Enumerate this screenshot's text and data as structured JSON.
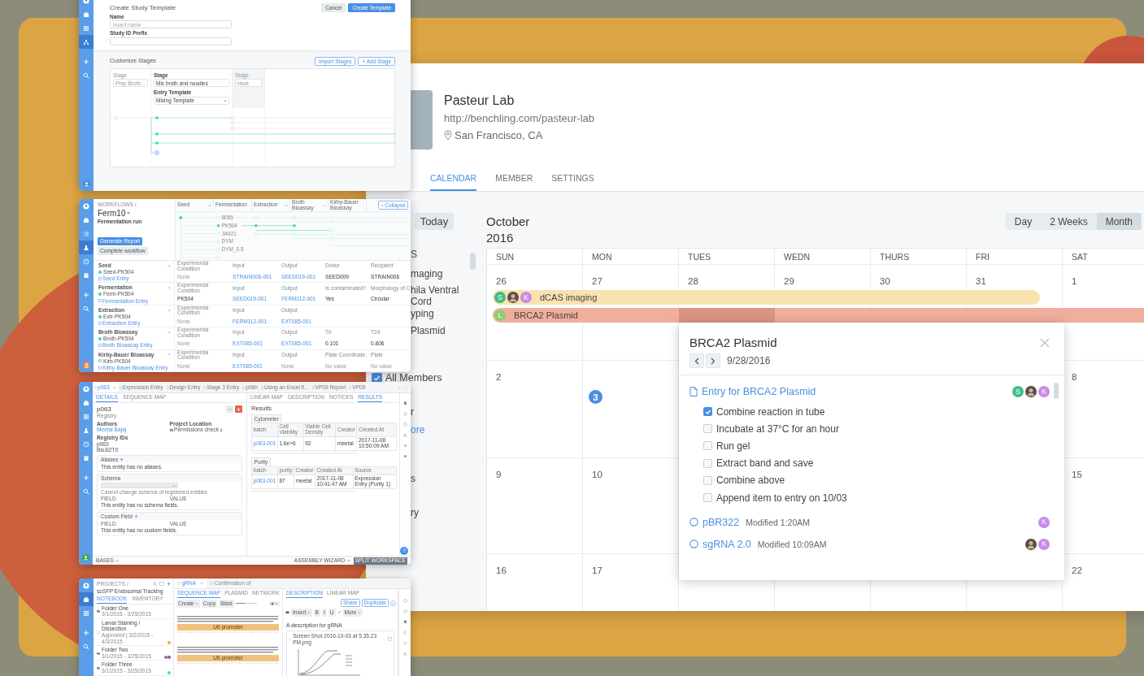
{
  "study_template": {
    "sidebar": [
      {
        "kind": "logo",
        "selected": false
      },
      {
        "kind": "briefcase",
        "selected": false
      },
      {
        "kind": "grid",
        "selected": false
      },
      {
        "kind": "hierarchy",
        "selected": true
      },
      {
        "kind": "plus",
        "selected": false
      },
      {
        "kind": "search",
        "selected": false
      }
    ],
    "title": "Create Study Template",
    "buttons": [
      {
        "label": "Cancel",
        "kind": "secondary"
      },
      {
        "label": "Create Template",
        "kind": "primary"
      }
    ],
    "fields": [
      {
        "label": "Name",
        "placeholder": "Insert name"
      },
      {
        "label": "Study ID Prefix"
      }
    ],
    "stages_title": "Customize Stages",
    "stage_buttons": [
      "Import Stages",
      "+ Add Stage"
    ],
    "stages": [
      {
        "label": "Stage",
        "value": "Prep Broth...",
        "active": false,
        "hovered": false
      },
      {
        "label": "Stage",
        "value": "Mix broth and noodles",
        "active": true,
        "hovered": false,
        "template_label": "Entry Template",
        "template": "Mixing Template"
      },
      {
        "label": "Stage",
        "value": "Heat",
        "active": false,
        "hovered": true
      }
    ]
  },
  "workflow": {
    "sidebar": [
      {
        "kind": "logo",
        "selected": false
      },
      {
        "kind": "briefcase",
        "selected": false
      },
      {
        "kind": "list",
        "selected": false
      },
      {
        "kind": "flask",
        "selected": true
      },
      {
        "kind": "clock",
        "selected": false
      },
      {
        "kind": "book",
        "selected": false
      },
      {
        "kind": "plus",
        "selected": false
      },
      {
        "kind": "search",
        "selected": false
      }
    ],
    "breadcrumb": "WORKFLOWS /",
    "title": "Ferm10",
    "subtitle": "Fermentation run",
    "buttons": [
      {
        "label": "Generate Report",
        "kind": "primary"
      },
      {
        "label": "Complete workflow",
        "kind": "secondary"
      }
    ],
    "columns": [
      "Seed",
      "Fermentation",
      "Extraction",
      "Broth Bioassay",
      "Kirby-Bauer Bioassay"
    ],
    "collapse": "Collapse",
    "nodes": [
      "8085",
      "PK504",
      "JA921",
      "DYM",
      "DYM_0.5"
    ],
    "stages": [
      {
        "name": "Seed",
        "entity": "Seed-PK504",
        "entry": "Seed Entry",
        "complete": true,
        "fields": [
          {
            "label": "Experimental Condition",
            "value": "None",
            "kind": "empty"
          },
          {
            "label": "Input",
            "value": "STRAIN006-001",
            "kind": "link"
          },
          {
            "label": "Output",
            "value": "SEED019-001",
            "kind": "link"
          },
          {
            "label": "Donor",
            "value": "SEED009",
            "kind": "text"
          },
          {
            "label": "Recipient",
            "value": "STRAIN006",
            "kind": "text"
          }
        ]
      },
      {
        "name": "Fermentation",
        "entity": "Ferm-PK504",
        "entry": "Fermentation Entry",
        "complete": true,
        "fields": [
          {
            "label": "Experimental Condition",
            "value": "PK504",
            "kind": "text"
          },
          {
            "label": "Input",
            "value": "SEED019-001",
            "kind": "link"
          },
          {
            "label": "Output",
            "value": "FERM112-001",
            "kind": "link"
          },
          {
            "label": "Is contaminated?",
            "value": "Yes",
            "kind": "text"
          },
          {
            "label": "Morphology of C",
            "value": "Circular",
            "kind": "text"
          }
        ]
      },
      {
        "name": "Extraction",
        "entity": "Extr-PK504",
        "entry": "Extraction Entry",
        "complete": true,
        "fields": [
          {
            "label": "Experimental Condition",
            "value": "None",
            "kind": "empty"
          },
          {
            "label": "Input",
            "value": "FERM112-001",
            "kind": "link"
          },
          {
            "label": "Output",
            "value": "EXT085-001",
            "kind": "link"
          }
        ]
      },
      {
        "name": "Broth Bioassay",
        "entity": "Broth-PK504",
        "entry": "Broth Bioassay Entry",
        "complete": true,
        "fields": [
          {
            "label": "Experimental Condition",
            "value": "None",
            "kind": "empty"
          },
          {
            "label": "Input",
            "value": "EXT085-001",
            "kind": "link"
          },
          {
            "label": "Output",
            "value": "EXT085-001",
            "kind": "link"
          },
          {
            "label": "T0",
            "value": "0.101",
            "kind": "text"
          },
          {
            "label": "T24",
            "value": "0.806",
            "kind": "text"
          }
        ]
      },
      {
        "name": "Kirby-Bauer Bioassay",
        "entity": "Kirb-PK504",
        "entry": "Kirby-Bauer Bioassay Entry",
        "complete": false,
        "fields": [
          {
            "label": "Experimental Condition",
            "value": "None",
            "kind": "empty"
          },
          {
            "label": "Input",
            "value": "EXT085-001",
            "kind": "link"
          },
          {
            "label": "Output",
            "value": "None",
            "kind": "empty"
          },
          {
            "label": "Plate Coordinate",
            "value": "No value",
            "kind": "empty"
          },
          {
            "label": "Plate",
            "value": "No value",
            "kind": "empty"
          }
        ]
      }
    ]
  },
  "entity": {
    "sidebar": [
      {
        "kind": "logo",
        "selected": false
      },
      {
        "kind": "briefcase",
        "selected": false
      },
      {
        "kind": "grid",
        "selected": false
      },
      {
        "kind": "flask",
        "selected": false
      },
      {
        "kind": "clock",
        "selected": false
      },
      {
        "kind": "book",
        "selected": false
      },
      {
        "kind": "plus",
        "selected": false
      },
      {
        "kind": "search",
        "selected": false
      }
    ],
    "tabs": [
      {
        "label": "p063",
        "selected": true
      },
      {
        "label": "Expression Entry",
        "selected": false
      },
      {
        "label": "Design Entry",
        "selected": false
      },
      {
        "label": "Stage 3 Entry",
        "selected": false
      },
      {
        "label": "p06h",
        "selected": false
      },
      {
        "label": "Using an Excel fi...",
        "selected": false
      },
      {
        "label": "VP09 Report",
        "selected": false
      },
      {
        "label": "VP09",
        "selected": false
      }
    ],
    "left_tabs": [
      {
        "label": "DETAILS",
        "selected": true
      },
      {
        "label": "SEQUENCE MAP",
        "selected": false
      }
    ],
    "name": "p063",
    "type": "Registry",
    "info": [
      {
        "label": "Authors",
        "value": "Meetal Bajaj",
        "kind": "link"
      },
      {
        "label": "Project Location",
        "value": "Permissions check",
        "kind": "folder"
      }
    ],
    "ids_label": "Registry IDs",
    "ids": [
      "p063",
      "Bio3i2TX"
    ],
    "sections": [
      {
        "title": "Aliases",
        "empty": "This entity has no aliases."
      },
      {
        "title": "Schema",
        "note": "Cannot change schema of registered entities",
        "columns": [
          "FIELD",
          "VALUE"
        ],
        "empty": "This entity has no schema fields."
      },
      {
        "title": "Custom Field",
        "columns": [
          "FIELD",
          "VALUE"
        ],
        "empty": "This entity has no custom fields."
      }
    ],
    "right_tabs": [
      {
        "label": "LINEAR MAP",
        "selected": false
      },
      {
        "label": "DESCRIPTION",
        "selected": false
      },
      {
        "label": "NOTICES",
        "selected": false
      },
      {
        "label": "RESULTS",
        "selected": true
      }
    ],
    "results_title": "Results",
    "tables": [
      {
        "name": "Cytometer",
        "columns": [
          "batch",
          "Cell Viability",
          "Viable Cell Density",
          "Creator",
          "Created At"
        ],
        "rows": [
          [
            "p063-001",
            "1.6e+6",
            "92",
            "meetal",
            "2017-11-08 10:50:09 AM"
          ]
        ]
      },
      {
        "name": "Purity",
        "columns": [
          "batch",
          "purity",
          "Creator",
          "Created At",
          "Source"
        ],
        "rows": [
          [
            "p063-001",
            "87",
            "meetal",
            "2017-11-08 10:41:47 AM",
            "Expression Entry (Purity 1)"
          ]
        ]
      }
    ],
    "status_bar": [
      "BASES",
      "ASSEMBLY WIZARD"
    ],
    "split_button": "SPLIT WORKSPACE",
    "help": "?"
  },
  "project": {
    "sidebar": [
      {
        "kind": "logo",
        "selected": false
      },
      {
        "kind": "briefcase",
        "selected": true
      },
      {
        "kind": "grid",
        "selected": false
      },
      {
        "kind": "plus",
        "selected": false
      },
      {
        "kind": "search",
        "selected": false
      }
    ],
    "breadcrumb": "PROJECTS /",
    "title": "scGFP Endosomal Tracking",
    "tabs": [
      {
        "label": "NOTEBOOK",
        "selected": true
      },
      {
        "label": "INVENTORY",
        "selected": false
      }
    ],
    "items": [
      {
        "kind": "folder",
        "name": "Folder One",
        "meta": "3/1/2015 - 3/25/2015"
      },
      {
        "kind": "entry",
        "name": "Larval Staining / Dissection",
        "meta": "Approved | 3/2/2015 - 4/3/2015",
        "avatars": [
          {
            "kind": "dot",
            "color": "#eaa94c"
          }
        ]
      },
      {
        "kind": "folder",
        "name": "Folder Two",
        "meta": "3/1/2015 - 3/25/2015",
        "avatars": [
          {
            "kind": "dot",
            "color": "#b45be0"
          },
          {
            "kind": "photo"
          }
        ]
      },
      {
        "kind": "folder",
        "name": "Folder Three",
        "meta": "3/1/2015 - 3/25/2015",
        "avatars": [
          {
            "kind": "dot",
            "color": "#5cd6a9"
          }
        ]
      }
    ],
    "doc_tabs": [
      {
        "label": "gRNA",
        "selected": true
      },
      {
        "label": "Confirmation of",
        "selected": false
      }
    ],
    "seq_tabs": [
      {
        "label": "SEQUENCE MAP",
        "selected": true
      },
      {
        "label": "PLASMID",
        "selected": false
      },
      {
        "label": "NETWORK",
        "selected": false
      }
    ],
    "seq_tools": [
      "Create",
      "Copy",
      "Blast"
    ],
    "zoom": {
      "level": 0.45
    },
    "annotations": [
      "U6 promoter",
      "U6 promoter"
    ],
    "desc_tabs": [
      {
        "label": "DESCRIPTION",
        "selected": true
      },
      {
        "label": "LINEAR MAP",
        "selected": false
      }
    ],
    "actions": [
      "Share",
      "Duplicate"
    ],
    "editor_tools": [
      "Insert",
      "B",
      "I",
      "U",
      "More"
    ],
    "description": "A description for gRNA",
    "attachment": "Screen Shot 2016-10-03 at 5.35.23 PM.png"
  },
  "lab": {
    "name": "Pasteur Lab",
    "url": "http://benchling.com/pasteur-lab",
    "location": "San Francisco, CA",
    "tabs": [
      {
        "label": "CALENDAR",
        "selected": true
      },
      {
        "label": "MEMBER",
        "selected": false
      },
      {
        "label": "SETTINGS",
        "selected": false
      }
    ],
    "today_button": "Today",
    "sidebar": [
      {
        "kind": "heading",
        "text": "S"
      },
      {
        "kind": "calendar",
        "text": "maging"
      },
      {
        "kind": "calendar",
        "text": "hila Ventral"
      },
      {
        "kind": "calendar",
        "text": "Cord"
      },
      {
        "kind": "calendar",
        "text": "yping"
      },
      {
        "kind": "calendar",
        "text": "Plasmid"
      },
      {
        "kind": "members",
        "text": "All Members",
        "checked": true
      },
      {
        "kind": "member",
        "text": "r"
      },
      {
        "kind": "link",
        "text": "ore"
      },
      {
        "kind": "heading",
        "text": "s"
      },
      {
        "kind": "member",
        "text": "ry"
      }
    ],
    "month": "October",
    "year": "2016",
    "views": [
      {
        "label": "Day",
        "selected": false
      },
      {
        "label": "2 Weeks",
        "selected": false
      },
      {
        "label": "Month",
        "selected": true
      }
    ],
    "weekdays": [
      "SUN",
      "MON",
      "TUES",
      "WEDN",
      "THURS",
      "FRI",
      "SAT"
    ],
    "weeks": [
      {
        "sun": {
          "date": "26",
          "today": false,
          "selected": false
        },
        "mon": {
          "date": "27",
          "today": false,
          "selected": false
        },
        "tues": {
          "date": "28",
          "today": false,
          "selected": true
        },
        "wedn": {
          "date": "29",
          "today": false,
          "selected": false
        },
        "thurs": {
          "date": "30",
          "today": false,
          "selected": false
        },
        "fri": {
          "date": "31",
          "today": false,
          "selected": false
        },
        "sat": {
          "date": "1",
          "today": false,
          "selected": false
        },
        "events": [
          {
            "title": "dCAS imaging",
            "color": "#f8e3b0",
            "avatars": [
              {
                "kind": "letter",
                "letter": "S",
                "color": "#3dbf87"
              },
              {
                "kind": "photo"
              },
              {
                "kind": "letter",
                "letter": "K",
                "color": "#c98ae6"
              }
            ],
            "continues": false,
            "selected": false
          },
          {
            "title": "BRCA2 Plasmid",
            "color": "#f0ae9c",
            "avatars": [
              {
                "kind": "letter",
                "letter": "L",
                "color": "#8bcf6e"
              }
            ],
            "continues": true,
            "selected": true
          }
        ]
      },
      {
        "sun": {
          "date": "2",
          "today": false,
          "selected": false
        },
        "mon": {
          "date": "3",
          "today": true,
          "selected": false
        },
        "sat": {
          "date": "8",
          "today": false,
          "selected": false
        }
      },
      {
        "sun": {
          "date": "9",
          "today": false,
          "selected": false
        },
        "mon": {
          "date": "10",
          "today": false,
          "selected": false
        },
        "sat": {
          "date": "15",
          "today": false,
          "selected": false
        }
      },
      {
        "sun": {
          "date": "16",
          "today": false,
          "selected": false
        },
        "mon": {
          "date": "17",
          "today": false,
          "selected": false
        },
        "sat": {
          "date": "22",
          "today": false,
          "selected": false
        }
      }
    ],
    "popup": {
      "title": "BRCA2 Plasmid",
      "date": "9/28/2016",
      "entry": {
        "title": "Entry for BRCA2 Plasmid",
        "avatars": [
          {
            "kind": "letter",
            "letter": "S",
            "color": "#3dbf87"
          },
          {
            "kind": "photo"
          },
          {
            "kind": "letter",
            "letter": "K",
            "color": "#c98ae6"
          }
        ]
      },
      "checklist": [
        {
          "text": "Combine reaction in tube",
          "checked": true
        },
        {
          "text": "Incubate at 37°C for an hour",
          "checked": false
        },
        {
          "text": "Run gel",
          "checked": false
        },
        {
          "text": "Extract band and save",
          "checked": false
        },
        {
          "text": "Combine above",
          "checked": false
        },
        {
          "text": "Append item to entry on 10/03",
          "checked": false
        }
      ],
      "items": [
        {
          "title": "pBR322",
          "meta": "Modified 1:20AM",
          "avatars": [
            {
              "kind": "letter",
              "letter": "K",
              "color": "#c98ae6"
            }
          ]
        },
        {
          "title": "sgRNA 2.0",
          "meta": "Modified 10:09AM",
          "avatars": [
            {
              "kind": "photo"
            },
            {
              "kind": "letter",
              "letter": "K",
              "color": "#c98ae6"
            }
          ]
        }
      ]
    }
  }
}
